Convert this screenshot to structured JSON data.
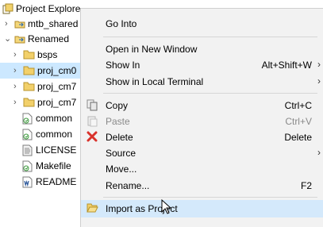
{
  "explorer": {
    "title": "Project Explore",
    "items": [
      {
        "label": "mtb_shared",
        "twisty": "›",
        "icon": "shared-project-icon"
      },
      {
        "label": "Renamed",
        "twisty": "⌄",
        "icon": "shared-project-icon"
      },
      {
        "label": "bsps",
        "twisty": "›",
        "icon": "folder-icon"
      },
      {
        "label": "proj_cm0",
        "twisty": "›",
        "icon": "folder-icon"
      },
      {
        "label": "proj_cm7",
        "twisty": "›",
        "icon": "folder-icon"
      },
      {
        "label": "proj_cm7",
        "twisty": "›",
        "icon": "folder-icon"
      },
      {
        "label": "common",
        "twisty": "",
        "icon": "file-link-icon"
      },
      {
        "label": "common",
        "twisty": "",
        "icon": "file-link-icon"
      },
      {
        "label": "LICENSE",
        "twisty": "",
        "icon": "text-file-icon"
      },
      {
        "label": "Makefile",
        "twisty": "",
        "icon": "file-link-icon"
      },
      {
        "label": "README",
        "twisty": "",
        "icon": "word-file-icon"
      }
    ]
  },
  "menu": {
    "go_into": "Go Into",
    "open_new_window": "Open in New Window",
    "show_in": "Show In",
    "show_in_shortcut": "Alt+Shift+W",
    "show_in_local_terminal": "Show in Local Terminal",
    "copy": "Copy",
    "copy_shortcut": "Ctrl+C",
    "paste": "Paste",
    "paste_shortcut": "Ctrl+V",
    "delete": "Delete",
    "delete_shortcut": "Delete",
    "source": "Source",
    "move": "Move...",
    "rename": "Rename...",
    "rename_shortcut": "F2",
    "import_as_project": "Import as Project",
    "submenu_arrow": "›"
  },
  "colors": {
    "selection": "#cce8ff",
    "hover": "#d4e9fb",
    "menu_bg": "#f2f2f2",
    "folder": "#e8c35a",
    "delete_red": "#d9322b"
  }
}
